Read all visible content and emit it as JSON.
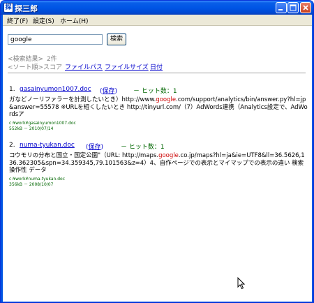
{
  "window": {
    "title": "探三郎",
    "app_icon_char": "探",
    "title_text_color": "#ffffff",
    "titlebar_color": "#0055e5"
  },
  "menu": {
    "items": [
      {
        "label": "終了(F)"
      },
      {
        "label": "設定(S)"
      },
      {
        "label": "ホーム(H)"
      }
    ]
  },
  "search": {
    "value": "google",
    "button_label": "検索"
  },
  "results_summary": {
    "label": "<検索結果>",
    "count": "2件",
    "sort_label": "<ソート順>",
    "sort_score": "スコア",
    "sort_options": [
      "ファイルパス",
      "ファイルサイズ",
      "日付"
    ]
  },
  "results": [
    {
      "index": "1.",
      "filename": "gasainyumon1007.doc",
      "save_label": "保存",
      "hits": "－ ヒット数：1",
      "snippet_before": "ガなどノーリファラーを計測したいとき）http://www.",
      "snippet_highlight": "google",
      "snippet_after": ".com/support/analytics/bin/answer.py?hl=jp&answer=55578 ※URLを短くしたいとき http://tinyurl.com/（7）AdWords連携（Analytics設定で、AdWordsア",
      "path": "c:¥work¥gasainyumon1007.doc",
      "info": "552kB － 2010/07/14"
    },
    {
      "index": "2.",
      "filename": "numa-tyukan.doc",
      "save_label": "保存",
      "hits": "－ ヒット数：1",
      "snippet_before": "コウモリの分布と国立・国定公園\"（URL: http://maps.",
      "snippet_highlight": "google",
      "snippet_after": ".co.jp/maps?hl=ja&ie=UTF8&ll=36.5626,136.362305&spn=34.359345,79.101563&z=4）4、自作ページでの表示とマイマップでの表示の違い 検索 操作性 データ",
      "path": "c:¥work¥numa-tyukan.doc",
      "info": "356kB － 2008/10/07"
    }
  ],
  "colors": {
    "link": "#0000cc",
    "hits": "#006600",
    "highlight": "#cc0000",
    "meta": "#006600",
    "menubar": "#ece9d8"
  },
  "icons": [
    "minimize-icon",
    "maximize-icon",
    "close-icon",
    "mouse-cursor-icon"
  ]
}
